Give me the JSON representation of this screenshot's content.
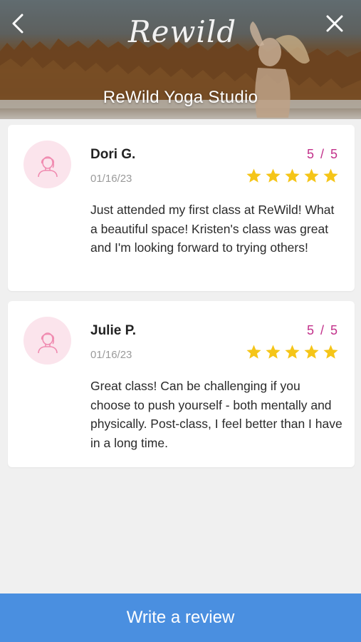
{
  "header": {
    "logo_text": "Rewild",
    "studio_name": "ReWild Yoga Studio"
  },
  "colors": {
    "accent_pink": "#c2308a",
    "star_yellow": "#f5c518",
    "button_blue": "#4a8fe0"
  },
  "reviews": [
    {
      "name": "Dori G.",
      "date": "01/16/23",
      "rating_text": "5 / 5",
      "stars": 5,
      "text": "Just attended my first class at ReWild! What a beautiful space! Kristen's class was great and I'm looking forward to trying others!"
    },
    {
      "name": "Julie P.",
      "date": "01/16/23",
      "rating_text": "5 / 5",
      "stars": 5,
      "text": "Great class! Can be challenging if you choose to push yourself - both mentally and physically. Post-class, I feel better than I have in a long time."
    }
  ],
  "footer": {
    "write_review_label": "Write a review"
  }
}
